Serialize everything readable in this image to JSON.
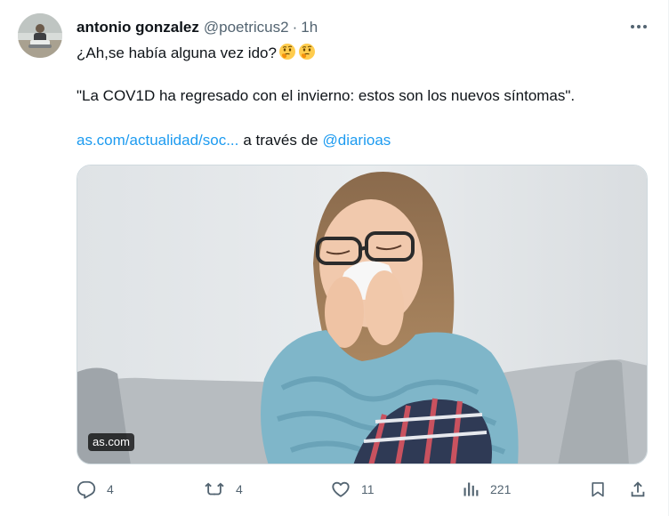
{
  "tweet": {
    "author_name": "antonio gonzalez",
    "author_handle": "@poetricus2",
    "separator": "·",
    "time": "1h",
    "line1_text": "¿Ah,se había alguna vez ido?",
    "line1_emojis": [
      "thinking-face-emoji",
      "thinking-face-emoji"
    ],
    "line2_text": "\"La COV1D ha regresado con el invierno: estos son los nuevos síntomas\".",
    "link_text": "as.com/actualidad/soc...",
    "via_text": "a través de",
    "mention_text": "@diarioas",
    "link_color": "#1d9bf0",
    "media": {
      "source_label": "as.com",
      "description_icon": "photo-woman-blowing-nose"
    }
  },
  "actions": {
    "reply": {
      "icon": "reply-icon",
      "count": "4"
    },
    "retweet": {
      "icon": "retweet-icon",
      "count": "4"
    },
    "like": {
      "icon": "heart-icon",
      "count": "11"
    },
    "views": {
      "icon": "views-icon",
      "count": "221"
    },
    "bookmark": {
      "icon": "bookmark-icon"
    },
    "share": {
      "icon": "share-icon"
    }
  },
  "colors": {
    "text_primary": "#0f1419",
    "text_secondary": "#536471",
    "accent": "#1d9bf0"
  }
}
